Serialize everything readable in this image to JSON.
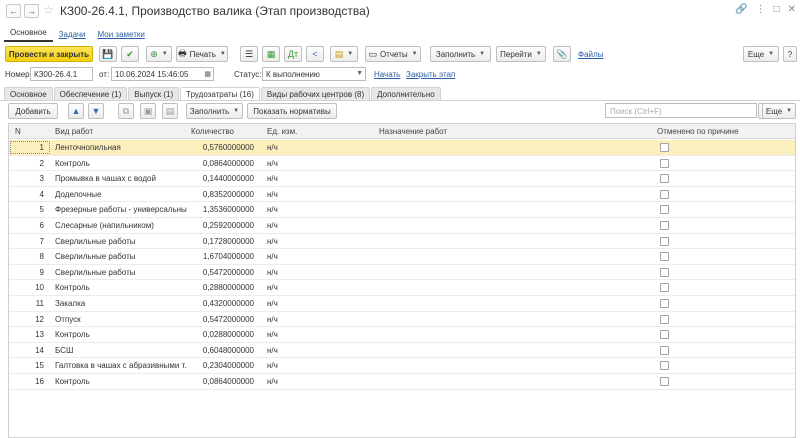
{
  "window": {
    "title": "КЗ00-26.4.1, Производство валика (Этап производства)",
    "back_icon": "←",
    "forward_icon": "→",
    "star_icon": "☆",
    "link_icon": "🔗",
    "more_icon": "⋮",
    "maximize_icon": "□",
    "close_icon": "✕"
  },
  "section_tabs": [
    "Основное",
    "Задачи",
    "Мои заметки"
  ],
  "toolbar": {
    "post_close": "Провести и закрыть",
    "print": "Печать",
    "reports": "Отчеты",
    "fill": "Заполнить",
    "go": "Перейти",
    "files": "Файлы",
    "more": "Еще",
    "help": "?"
  },
  "fields": {
    "number_label": "Номер:",
    "number_value": "КЗ00-26.4.1",
    "from_label": "от:",
    "date_value": "10.06.2024 15:46:05",
    "status_label": "Статус:",
    "status_value": "К выполнению",
    "start_link": "Начать",
    "close_link": "Закрыть этап"
  },
  "page_tabs": [
    "Основное",
    "Обеспечение (1)",
    "Выпуск (1)",
    "Трудозатраты (16)",
    "Виды рабочих центров (8)",
    "Дополнительно"
  ],
  "active_page_tab": 3,
  "table_toolbar": {
    "add": "Добавить",
    "fill": "Заполнить",
    "show_norms": "Показать нормативы",
    "search_placeholder": "Поиск (Ctrl+F)",
    "more": "Еще"
  },
  "table": {
    "columns": [
      "N",
      "Вид работ",
      "Количество",
      "Ед. изм.",
      "Назначение работ",
      "Отменено по причине"
    ],
    "rows": [
      {
        "n": "1",
        "work": "Ленточнопильная",
        "qty": "0,5760000000",
        "unit": "н/ч"
      },
      {
        "n": "2",
        "work": "Контроль",
        "qty": "0,0864000000",
        "unit": "н/ч"
      },
      {
        "n": "3",
        "work": "Промывка в чашах с водой",
        "qty": "0,1440000000",
        "unit": "н/ч"
      },
      {
        "n": "4",
        "work": "Доделочные",
        "qty": "0,8352000000",
        "unit": "н/ч"
      },
      {
        "n": "5",
        "work": "Фрезерные работы - универсальны...",
        "qty": "1,3536000000",
        "unit": "н/ч"
      },
      {
        "n": "6",
        "work": "Слесарные (напильником)",
        "qty": "0,2592000000",
        "unit": "н/ч"
      },
      {
        "n": "7",
        "work": "Сверлильные работы",
        "qty": "0,1728000000",
        "unit": "н/ч"
      },
      {
        "n": "8",
        "work": "Сверлильные работы",
        "qty": "1,6704000000",
        "unit": "н/ч"
      },
      {
        "n": "9",
        "work": "Сверлильные работы",
        "qty": "0,5472000000",
        "unit": "н/ч"
      },
      {
        "n": "10",
        "work": "Контроль",
        "qty": "0,2880000000",
        "unit": "н/ч"
      },
      {
        "n": "11",
        "work": "Закалка",
        "qty": "0,4320000000",
        "unit": "н/ч"
      },
      {
        "n": "12",
        "work": "Отпуск",
        "qty": "0,5472000000",
        "unit": "н/ч"
      },
      {
        "n": "13",
        "work": "Контроль",
        "qty": "0,0288000000",
        "unit": "н/ч"
      },
      {
        "n": "14",
        "work": "БСШ",
        "qty": "0,6048000000",
        "unit": "н/ч"
      },
      {
        "n": "15",
        "work": "Галтовка в чашах с абразивными т...",
        "qty": "0,2304000000",
        "unit": "н/ч"
      },
      {
        "n": "16",
        "work": "Контроль",
        "qty": "0,0864000000",
        "unit": "н/ч"
      }
    ]
  },
  "colors": {
    "primary_button": "#f5cf10",
    "selected_row": "#fcefbe",
    "link": "#2d5ea8"
  }
}
